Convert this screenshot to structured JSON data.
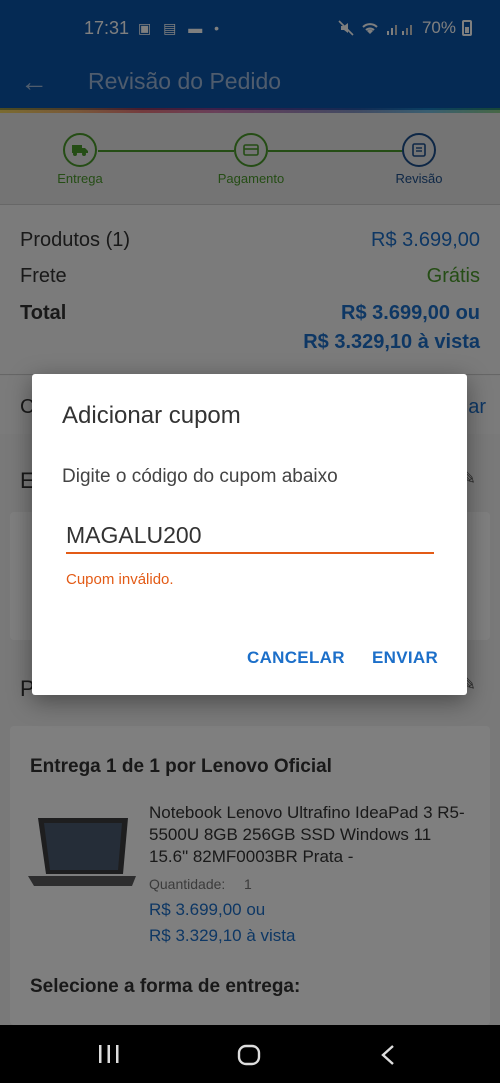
{
  "status_bar": {
    "time": "17:31",
    "notifications": "▣ ▤ ▬ •",
    "battery": "70%",
    "icons": [
      "mute-icon",
      "wifi-icon",
      "signal-icon",
      "battery-icon"
    ]
  },
  "header": {
    "title": "Revisão do Pedido"
  },
  "steps": [
    {
      "label": "Entrega",
      "icon": "truck-icon",
      "color": "#4a9a2a"
    },
    {
      "label": "Pagamento",
      "icon": "card-icon",
      "color": "#4a9a2a"
    },
    {
      "label": "Revisão",
      "icon": "document-icon",
      "color": "#1c4f8c"
    }
  ],
  "summary": {
    "products_label": "Produtos (1)",
    "products_value": "R$ 3.699,00",
    "shipping_label": "Frete",
    "shipping_value": "Grátis",
    "total_label": "Total",
    "total_value_1": "R$ 3.699,00 ou",
    "total_value_2": "R$ 3.329,10 à vista"
  },
  "coupon_row": {
    "left": "C",
    "right": "ar"
  },
  "behind": {
    "section1_letter": "E",
    "section2_letter": "P",
    "delivery_title": "Entrega 1 de 1 por Lenovo Oficial",
    "product_name": "Notebook Lenovo Ultrafino IdeaPad 3 R5-5500U 8GB 256GB SSD Windows 11 15.6\" 82MF0003BR Prata -",
    "quantity_label": "Quantidade:",
    "quantity_value": "1",
    "price_1": "R$ 3.699,00 ou",
    "price_2": "R$ 3.329,10 à vista",
    "delivery_select": "Selecione a forma de entrega:"
  },
  "dialog": {
    "title": "Adicionar cupom",
    "message": "Digite o código do cupom abaixo",
    "input_value": "MAGALU200",
    "error": "Cupom inválido.",
    "cancel": "CANCELAR",
    "send": "ENVIAR"
  },
  "colors": {
    "primary": "#0b55a8",
    "green": "#4a9a2a",
    "blue_text": "#1c6fc9",
    "error": "#e35b16"
  }
}
